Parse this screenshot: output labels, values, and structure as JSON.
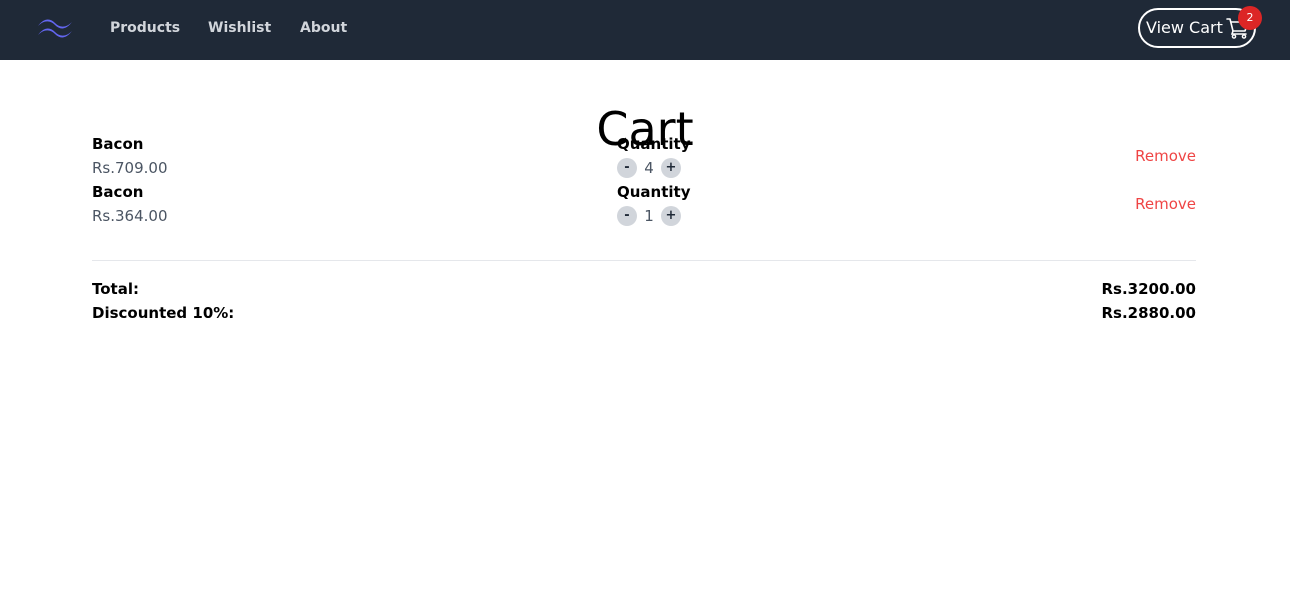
{
  "nav": {
    "logo_icon": "tailwind-logo-icon",
    "links": [
      "Products",
      "Wishlist",
      "About"
    ],
    "cart_button_label": "View Cart",
    "cart_icon": "shopping-cart-icon",
    "cart_count": "2"
  },
  "page": {
    "title": "Cart"
  },
  "cart": {
    "items": [
      {
        "name": "Bacon",
        "price": "Rs.709.00",
        "quantity_label": "Quantity",
        "quantity": "4",
        "minus_label": "-",
        "plus_label": "+",
        "remove_label": "Remove"
      },
      {
        "name": "Bacon",
        "price": "Rs.364.00",
        "quantity_label": "Quantity",
        "quantity": "1",
        "minus_label": "-",
        "plus_label": "+",
        "remove_label": "Remove"
      }
    ]
  },
  "summary": {
    "total_label": "Total:",
    "total_value": "Rs.3200.00",
    "discount_label": "Discounted 10%:",
    "discount_value": "Rs.2880.00"
  },
  "colors": {
    "navbar_bg": "#1f2937",
    "logo": "#6366f1",
    "badge": "#dc2626",
    "remove": "#ef4444"
  }
}
